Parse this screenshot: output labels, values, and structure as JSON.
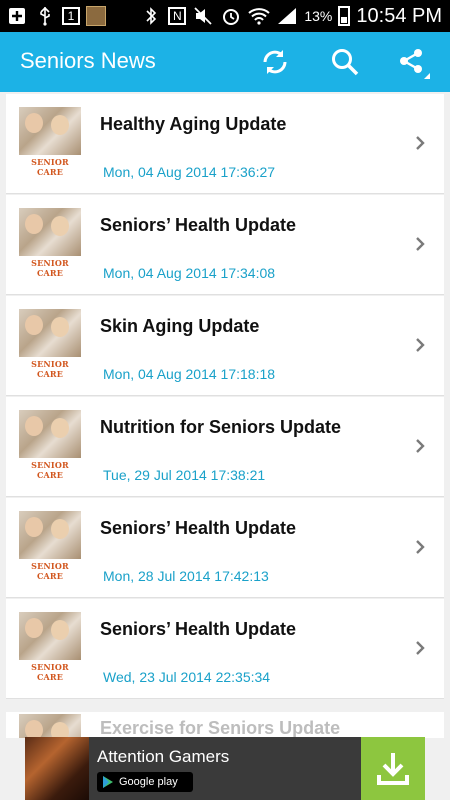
{
  "status_bar": {
    "battery_pct": "13%",
    "time": "10:54 PM",
    "notification_box_text": "1",
    "nfc_letter": "N"
  },
  "app_bar": {
    "title": "Seniors News",
    "icons": [
      "refresh-icon",
      "search-icon",
      "share-icon"
    ]
  },
  "thumb_label": "SENIOR CARE",
  "items": [
    {
      "title": "Healthy Aging Update",
      "date": "Mon, 04 Aug 2014 17:36:27"
    },
    {
      "title": "Seniors’ Health Update",
      "date": "Mon, 04 Aug 2014 17:34:08"
    },
    {
      "title": "Skin Aging Update",
      "date": "Mon, 04 Aug 2014 17:18:18"
    },
    {
      "title": "Nutrition for Seniors Update",
      "date": "Tue, 29 Jul 2014 17:38:21"
    },
    {
      "title": "Seniors’ Health Update",
      "date": "Mon, 28 Jul 2014 17:42:13"
    },
    {
      "title": "Seniors’ Health Update",
      "date": "Wed, 23 Jul 2014 22:35:34"
    }
  ],
  "partial_item": {
    "title": "Exercise for Seniors Update"
  },
  "ad": {
    "title": "Attention Gamers",
    "store": "Google play"
  },
  "colors": {
    "accent": "#1cb2e6",
    "date": "#1aa1c9",
    "ad_download": "#8dc63f"
  }
}
